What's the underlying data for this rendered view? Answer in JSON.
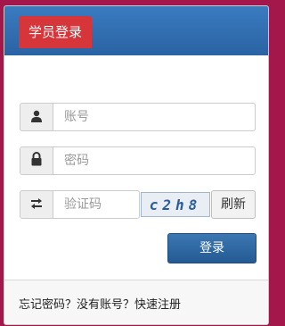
{
  "header": {
    "title": "学员登录"
  },
  "form": {
    "account": {
      "placeholder": "账号",
      "icon": "user-icon"
    },
    "password": {
      "placeholder": "密码",
      "icon": "lock-icon"
    },
    "captcha": {
      "placeholder": "验证码",
      "icon": "swap-arrows-icon",
      "image_text": "c2h8",
      "refresh_label": "刷新"
    },
    "login_label": "登录"
  },
  "footer": {
    "forgot_password": "忘记密码？",
    "no_account": "没有账号？",
    "quick_register": "快速注册"
  },
  "colors": {
    "background": "#a4174a",
    "header": "#2f6db0",
    "title_tab": "#d6353a",
    "login_button": "#2f6aa6"
  }
}
